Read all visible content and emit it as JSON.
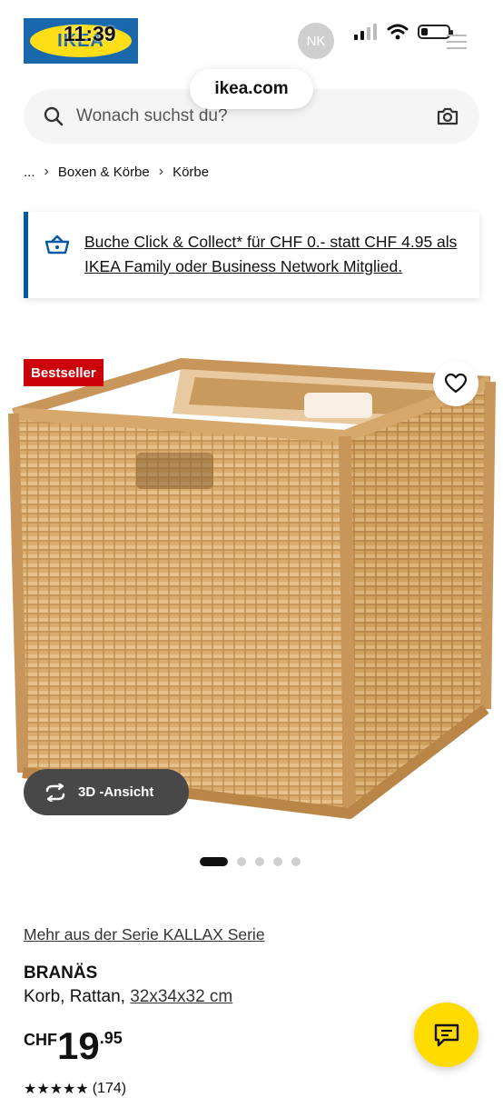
{
  "status_bar": {
    "time": "11:39",
    "avatar_initials": "NK",
    "battery_level": 0.25
  },
  "header": {
    "logo_text": "IKEA",
    "url": "ikea.com"
  },
  "search": {
    "placeholder": "Wonach suchst du?",
    "icons": [
      "search-icon",
      "camera-icon"
    ]
  },
  "breadcrumb": {
    "items": [
      "...",
      "Boxen & Körbe",
      "Körbe"
    ]
  },
  "promo": {
    "text": "Buche Click & Collect* für CHF 0.- statt CHF 4.95 als IKEA Family oder Business Network Mitglied.",
    "icon": "basket-icon"
  },
  "product": {
    "badge": "Bestseller",
    "view_3d_label": "3D -Ansicht",
    "image_count": 5,
    "active_image": 1,
    "series_link": "Mehr aus der Serie KALLAX Serie",
    "name": "BRANÄS",
    "description": "Korb, Rattan, ",
    "size": "32x34x32 cm",
    "price": {
      "currency": "CHF",
      "integer": "19",
      "decimals": ".95"
    },
    "rating_count": "(174)"
  },
  "colors": {
    "ikea_blue": "#0058a3",
    "ikea_yellow": "#ffdb00",
    "badge_red": "#cc0008"
  }
}
